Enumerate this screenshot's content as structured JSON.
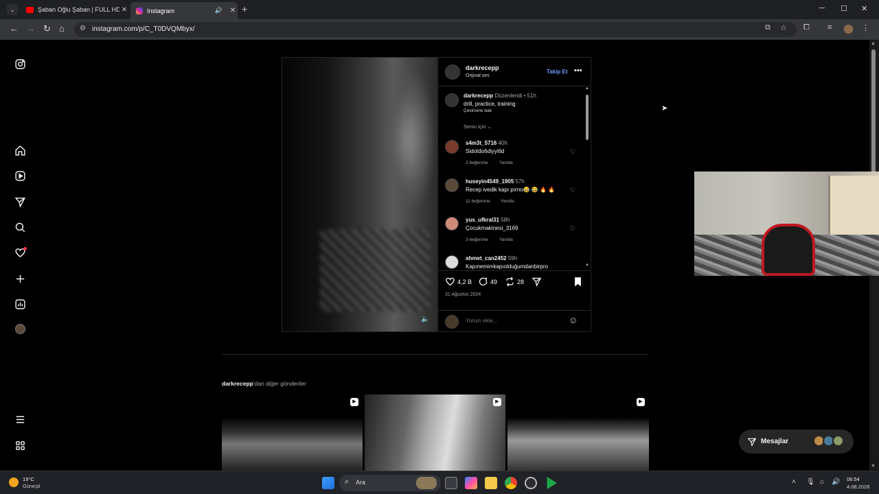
{
  "browser": {
    "tabs": [
      {
        "title": "Şaban Oğlu Şaban | FULL HD - Y",
        "favicon_color": "#ff0000"
      },
      {
        "title": "Instagram",
        "favicon_color": "#d6249f"
      }
    ],
    "url": "instagram.com/p/C_T0DVQMbyx/"
  },
  "post": {
    "author": "darkrecepp",
    "audio": "Orijinal ses",
    "follow_label": "Takip Et",
    "caption": {
      "user": "darkrecepp",
      "meta": "Düzenlendi • 51h",
      "text": "drill, practice, training",
      "translate": "Çevirisine bak"
    },
    "sort_label": "Senin için",
    "comments": [
      {
        "user": "s4m3t_5716",
        "time": "40h",
        "text": "Sidotdo6diyyi6d",
        "likes": "2 beğenme",
        "reply": "Yanıtla",
        "avatar_color": "#7a3a2a"
      },
      {
        "user": "huseyin4549_1905",
        "time": "57h",
        "text": "Recep ivedik kapı pırno😂 😂 🔥 🔥",
        "likes": "11 beğenme",
        "reply": "Yanıtla",
        "avatar_color": "#5a4a3a"
      },
      {
        "user": "yus_ufkral31",
        "time": "58h",
        "text": "Çocukmakinesi_3169",
        "likes": "3 beğenme",
        "reply": "Yanıtla",
        "avatar_color": "#d08a7a"
      },
      {
        "user": "ahmet_can2452",
        "time": "59h",
        "text": "Kapınemimkapıolduğumdanbirpro",
        "likes": "",
        "reply": "",
        "avatar_color": "#dddddd"
      }
    ],
    "likes": "4,2 B",
    "comment_count": "49",
    "repost_count": "28",
    "date": "31 Ağustos 2024",
    "add_comment_placeholder": "Yorum ekle..."
  },
  "more_posts": {
    "user": "darkrecepp",
    "suffix": "'dan diğer gönderiler"
  },
  "messages": {
    "label": "Mesajlar"
  },
  "taskbar": {
    "weather_temp": "19°C",
    "weather_desc": "Güneşli",
    "search_label": "Ara",
    "time": "06:54",
    "date": "4.08.2026"
  }
}
